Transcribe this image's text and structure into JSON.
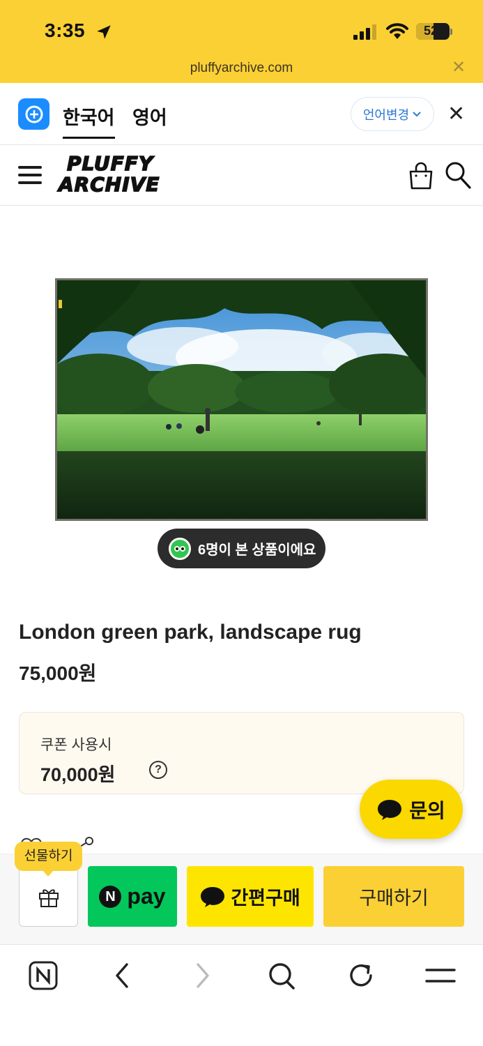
{
  "status_bar": {
    "time": "3:35",
    "battery": "52",
    "battery_level": 0.52
  },
  "browser": {
    "url": "pluffyarchive.com"
  },
  "translate_bar": {
    "lang_source": "한국어",
    "lang_target": "영어",
    "change_label": "언어변경"
  },
  "site": {
    "logo_line1": "PLUFFY",
    "logo_line2": "ARCHIVE"
  },
  "product": {
    "viewers_text": "6명이 본 상품이에요",
    "title": "London green park, landscape rug",
    "price": "75,000원",
    "coupon_label": "쿠폰 사용시",
    "coupon_price": "70,000원",
    "help_symbol": "?"
  },
  "floating": {
    "inquiry_label": "문의"
  },
  "purchase_bar": {
    "gift_tag": "선물하기",
    "npay_n": "N",
    "npay_label": "pay",
    "kakao_label": "간편구매",
    "buy_label": "구매하기"
  },
  "colors": {
    "brand_yellow": "#fbd034",
    "naver_green": "#03c75a",
    "kakao_yellow": "#fee500",
    "translate_blue": "#1a8cff"
  }
}
